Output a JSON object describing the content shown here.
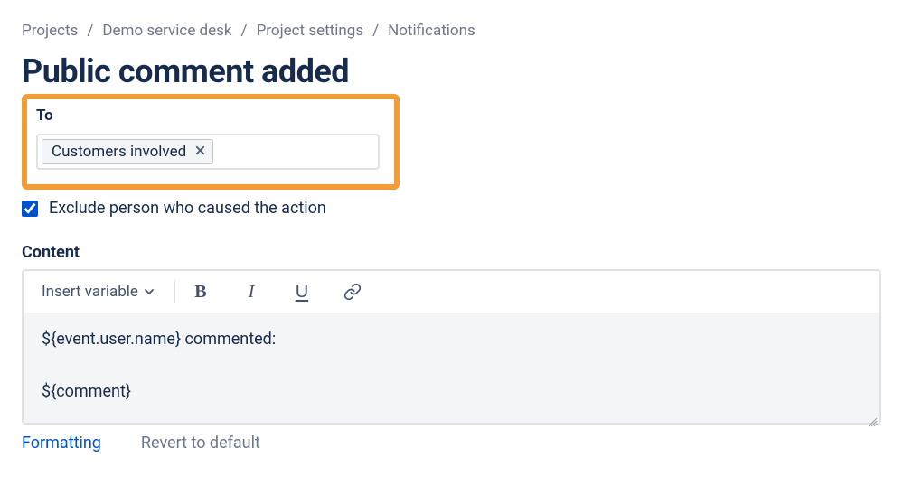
{
  "breadcrumb": {
    "items": [
      "Projects",
      "Demo service desk",
      "Project settings",
      "Notifications"
    ],
    "separator": "/"
  },
  "page": {
    "title": "Public comment added"
  },
  "to_field": {
    "label": "To",
    "chips": [
      {
        "label": "Customers involved"
      }
    ]
  },
  "exclude_checkbox": {
    "label": "Exclude person who caused the action",
    "checked": true
  },
  "content": {
    "label": "Content",
    "toolbar": {
      "insert_variable": "Insert variable",
      "bold": "B",
      "italic": "I",
      "underline": "U"
    },
    "body": "${event.user.name} commented:\n\n${comment}"
  },
  "footer": {
    "formatting": "Formatting",
    "revert": "Revert to default"
  }
}
